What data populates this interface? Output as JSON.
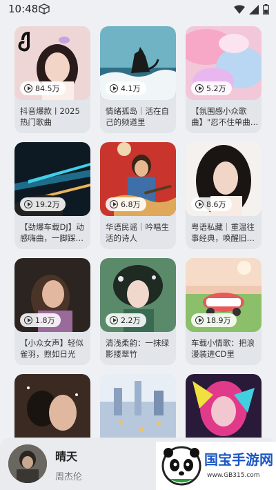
{
  "status_bar": {
    "time": "10:48"
  },
  "cards": [
    {
      "plays": "84.5万",
      "title": "抖音爆款丨2025热门歌曲"
    },
    {
      "plays": "4.1万",
      "title": "情绪孤岛｜活在自己的频道里"
    },
    {
      "plays": "5.2万",
      "title": "【氛围感小众歌曲】\"忍不住单曲…"
    },
    {
      "plays": "19.2万",
      "title": "【劲爆车载DJ】动感嗨曲，一脚踩…"
    },
    {
      "plays": "6.8万",
      "title": "华语民谣｜吟唱生活的诗人"
    },
    {
      "plays": "8.6万",
      "title": "粤语私藏｜重温往事经典，唤醒旧…"
    },
    {
      "plays": "1.8万",
      "title": "【小众女声】轻似雀羽，煦如日光"
    },
    {
      "plays": "2.2万",
      "title": "清浅柔韵：一抹绿影搂翠竹"
    },
    {
      "plays": "18.9万",
      "title": "车载小情歌：把浪漫装进CD里"
    },
    {
      "plays": "",
      "title": ""
    },
    {
      "plays": "",
      "title": ""
    },
    {
      "plays": "",
      "title": ""
    }
  ],
  "player": {
    "song": "晴天",
    "artist": "周杰伦"
  },
  "watermark": {
    "name": "国宝手游网",
    "url": "www.GB315.com"
  }
}
